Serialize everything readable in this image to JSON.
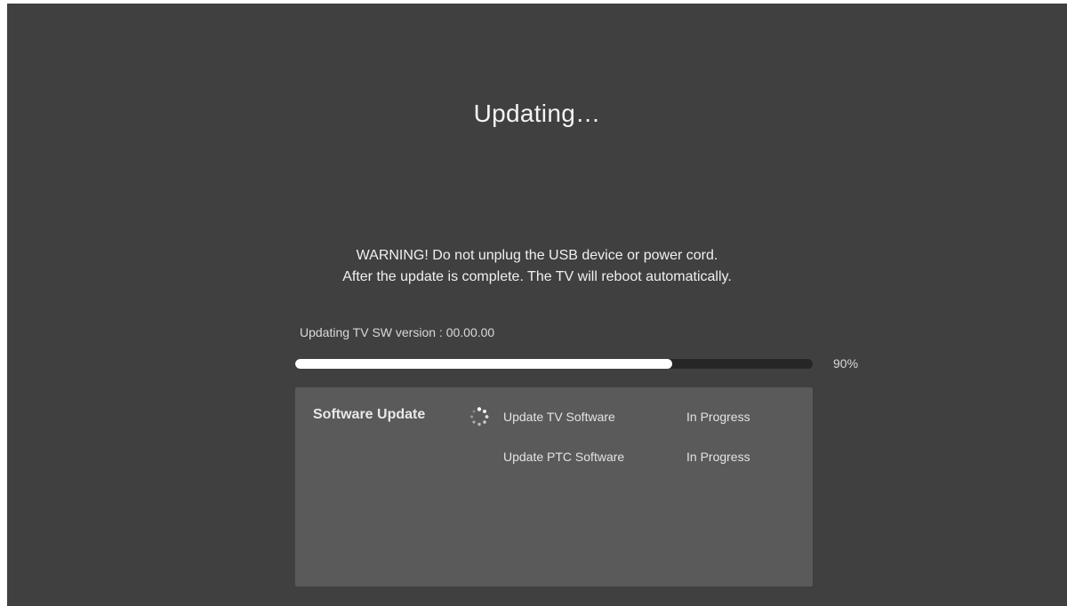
{
  "header": {
    "title": "Updating…"
  },
  "warning": {
    "line1": "WARNING! Do not unplug the USB device or power cord.",
    "line2": "After the update is complete. The TV will reboot automatically."
  },
  "progress": {
    "version_label": "Updating TV SW version : 00.00.00",
    "value_percent": 90,
    "percent_label": "90%"
  },
  "panel": {
    "title": "Software Update",
    "tasks": [
      {
        "name": "Update TV Software",
        "status": "In Progress",
        "icon": "loading-spinner-icon"
      },
      {
        "name": "Update PTC Software",
        "status": "In Progress"
      }
    ]
  },
  "colors": {
    "background": "#404040",
    "panel": "#5a5a5a",
    "progress_track": "#262626",
    "progress_fill": "#ffffff",
    "text": "#f2f2f2"
  }
}
